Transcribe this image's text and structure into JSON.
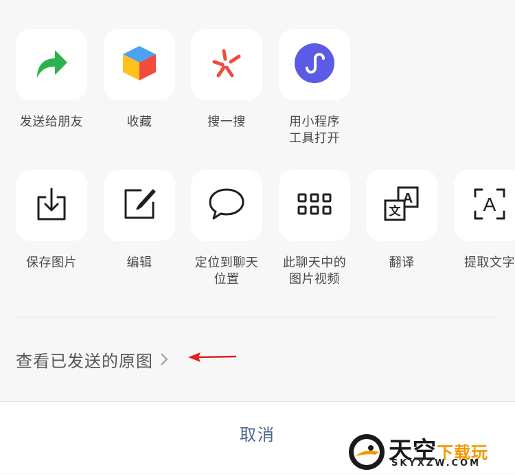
{
  "share_sheet": {
    "row1": [
      {
        "label": "发送给朋友",
        "icon": "forward-arrow-icon"
      },
      {
        "label": "收藏",
        "icon": "favorites-cube-icon"
      },
      {
        "label": "搜一搜",
        "icon": "search-star-icon"
      },
      {
        "label": "用小程序\n工具打开",
        "icon": "mini-program-icon"
      }
    ],
    "row2": [
      {
        "label": "保存图片",
        "icon": "download-icon"
      },
      {
        "label": "编辑",
        "icon": "edit-pen-icon"
      },
      {
        "label": "定位到聊天\n位置",
        "icon": "chat-bubble-icon"
      },
      {
        "label": "此聊天中的\n图片视频",
        "icon": "grid-icon"
      },
      {
        "label": "翻译",
        "icon": "translate-icon"
      },
      {
        "label": "提取文字",
        "icon": "text-scan-icon"
      }
    ],
    "view_original": "查看已发送的原图",
    "cancel": "取消"
  },
  "watermark": {
    "main_a": "天空",
    "main_b": "下载玩",
    "url": "SKYXZW.COM"
  },
  "colors": {
    "accent_green": "#2bb24c",
    "mini_program_purple": "#5b5be6",
    "search_red": "#f04b3e",
    "arrow_red": "#e02020",
    "cancel_text": "#4a6589"
  }
}
